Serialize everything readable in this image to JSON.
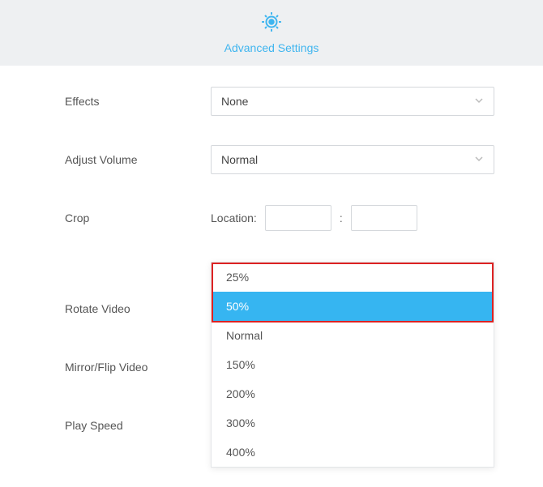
{
  "header": {
    "title": "Advanced Settings",
    "icon": "gear-icon"
  },
  "fields": {
    "effects": {
      "label": "Effects",
      "value": "None"
    },
    "adjust_volume": {
      "label": "Adjust Volume",
      "value": "Normal"
    },
    "crop": {
      "label": "Crop",
      "location_label": "Location:",
      "x": "",
      "y": "",
      "sep": ":"
    },
    "rotate_video": {
      "label": "Rotate Video"
    },
    "mirror_flip": {
      "label": "Mirror/Flip Video"
    },
    "play_speed": {
      "label": "Play Speed",
      "value": "50%"
    }
  },
  "play_speed_options": [
    "25%",
    "50%",
    "Normal",
    "150%",
    "200%",
    "300%",
    "400%"
  ],
  "play_speed_selected_index": 1
}
